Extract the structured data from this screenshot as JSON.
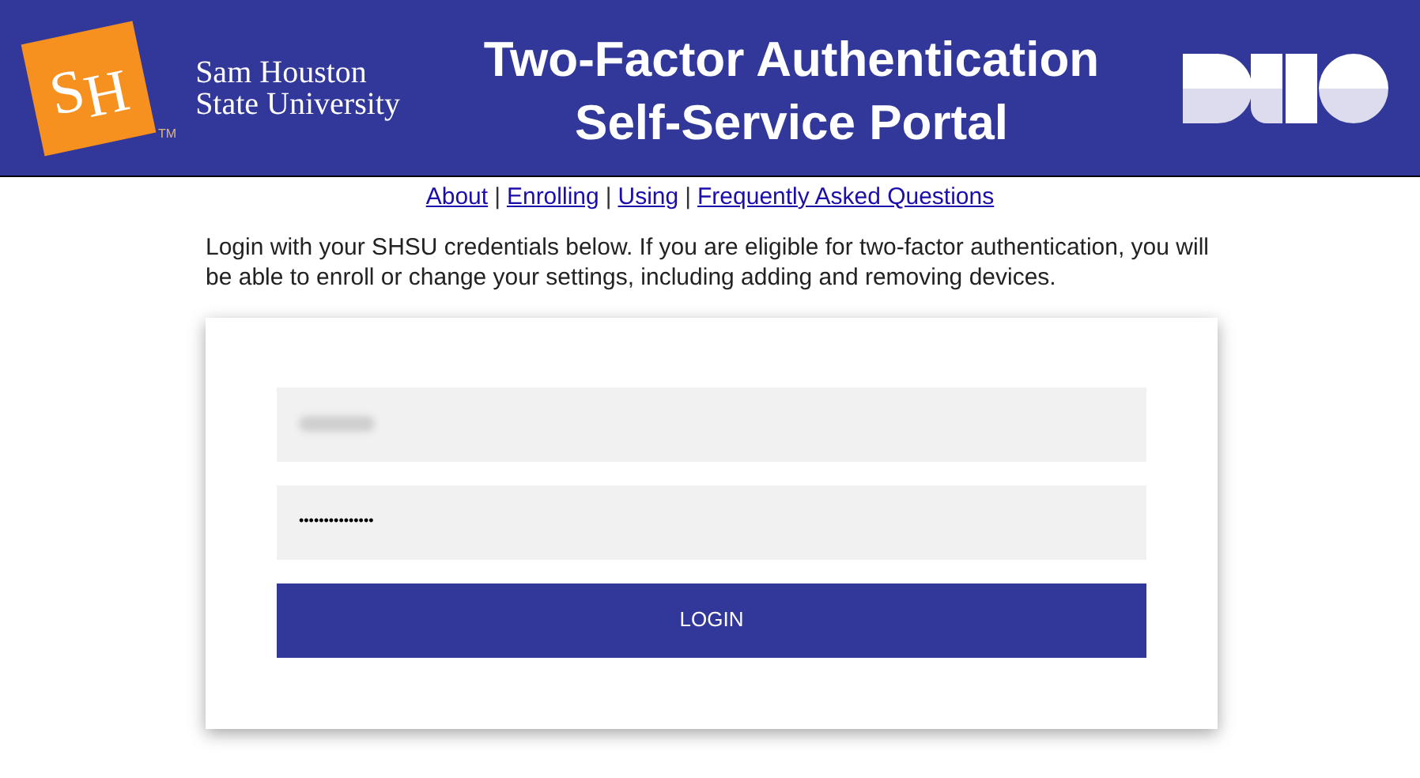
{
  "header": {
    "logo_letters": [
      "S",
      "H"
    ],
    "logo_trademark": "TM",
    "university": [
      "Sam Houston",
      "State University"
    ],
    "title": [
      "Two-Factor Authentication",
      "Self-Service Portal"
    ]
  },
  "nav_links": [
    "About",
    "Enrolling",
    "Using",
    "Frequently Asked Questions"
  ],
  "nav_separator": "|",
  "intro": "Login with your SHSU credentials below. If you are eligible for two-factor authentication, you will be able to enroll or change your settings, including adding and removing devices.",
  "login_form": {
    "username": {
      "redacted": true
    },
    "password": {
      "value": "•••••••••••••••"
    },
    "submit": "LOGIN"
  }
}
